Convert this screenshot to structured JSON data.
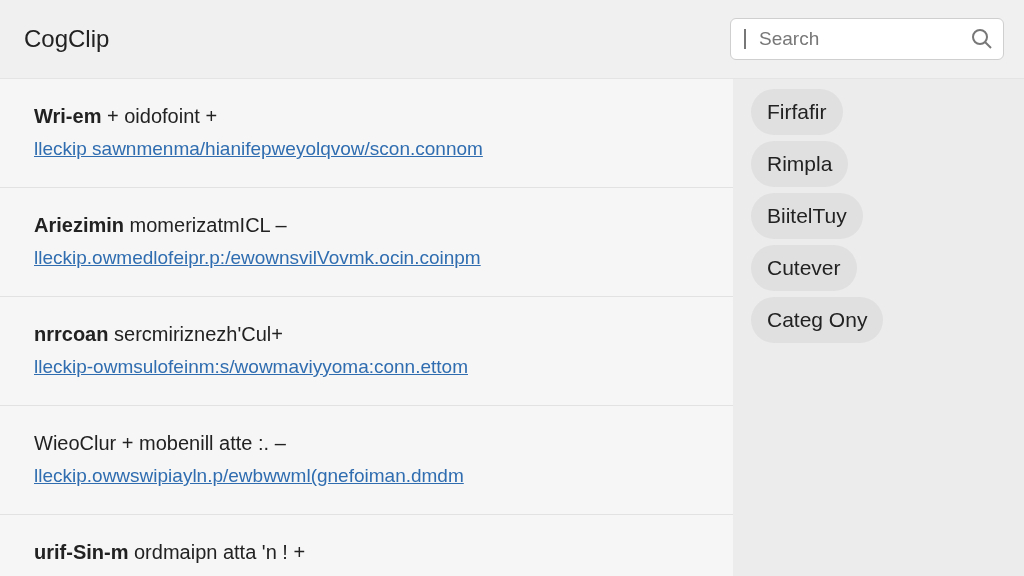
{
  "app": {
    "title": "CogClip"
  },
  "search": {
    "placeholder": "Search"
  },
  "items": [
    {
      "title": "**Wri-em** + oidofoint +",
      "link": "lleckip sawnmenma/hianifepweyolqvow/scon.connom"
    },
    {
      "title": "**Ariezimin** momerizatmICL –",
      "link": "lleckip.owmedlofeipr.p:/ewownsvilVovmk.ocin.coinpm"
    },
    {
      "title": "**nrrcoan** sercmiriznezh'Cul+",
      "link": "lleckip-owmsulofeinm:s/wowmaviyyoma:conn.ettom"
    },
    {
      "title": "WieoClur + mobenill atte :. –",
      "link": "lleckip.owwswipiayln.p/ewbwwml(gnefoiman.dmdm"
    },
    {
      "title": "**urif-Sin-m** ordmaipn atta 'n ! +"
    }
  ],
  "categories": [
    "Firfafir",
    "Rimpla",
    "BiitelTuy",
    "Cutever",
    "Categ Ony"
  ]
}
